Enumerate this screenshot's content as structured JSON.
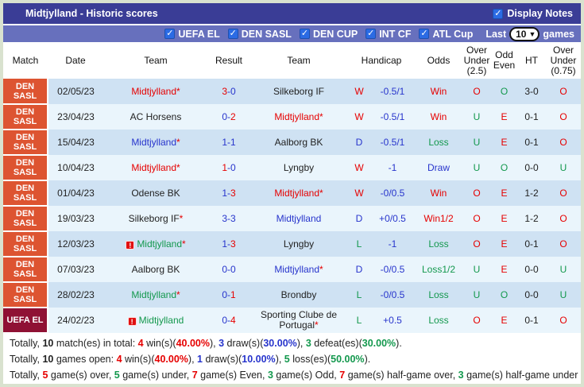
{
  "titlebar": {
    "title": "Midtjylland - Historic scores",
    "display_notes": "Display Notes"
  },
  "filterbar": {
    "checkboxes": [
      "UEFA EL",
      "DEN SASL",
      "DEN CUP",
      "INT CF",
      "ATL Cup"
    ],
    "last": "Last",
    "selected": "10",
    "games": "games"
  },
  "colors": {
    "titlebar_bg": "#3a3d96",
    "filterbar_bg": "#6770bd",
    "den_sasl_bg": "#dd5431",
    "uefa_el_bg": "#8f1134",
    "row_odd_bg": "#cfe2f3",
    "row_even_bg": "#eaf5fc",
    "win_red": "#e60000",
    "draw_blue": "#2734cc",
    "loss_green": "#13984d"
  },
  "table": {
    "headers": [
      "Match",
      "Date",
      "Team",
      "Result",
      "Team",
      "Handicap",
      "Odds",
      "Over\nUnder\n(2.5)",
      "Odd\nEven",
      "HT",
      "Over\nUnder\n(0.75)"
    ],
    "rows": [
      {
        "league": "DEN SASL",
        "league_type": "densasl",
        "date": "02/05/23",
        "home": {
          "name": "Midtjylland",
          "star": true,
          "color": "red"
        },
        "result": {
          "home": "3",
          "away": "0",
          "home_color": "red",
          "away_color": "blue"
        },
        "away": {
          "name": "Silkeborg IF",
          "star": false,
          "color": "black"
        },
        "wdl": {
          "t": "W",
          "c": "red"
        },
        "handicap": "-0.5/1",
        "odds": {
          "t": "Win",
          "c": "red"
        },
        "ou25": {
          "t": "O",
          "c": "red"
        },
        "oddeven": {
          "t": "O",
          "c": "green"
        },
        "ht": "3-0",
        "ou075": {
          "t": "O",
          "c": "red"
        }
      },
      {
        "league": "DEN SASL",
        "league_type": "densasl",
        "date": "23/04/23",
        "home": {
          "name": "AC Horsens",
          "star": false,
          "color": "black"
        },
        "result": {
          "home": "0",
          "away": "2",
          "home_color": "blue",
          "away_color": "red"
        },
        "away": {
          "name": "Midtjylland",
          "star": true,
          "color": "red"
        },
        "wdl": {
          "t": "W",
          "c": "red"
        },
        "handicap": "-0.5/1",
        "odds": {
          "t": "Win",
          "c": "red"
        },
        "ou25": {
          "t": "U",
          "c": "green"
        },
        "oddeven": {
          "t": "E",
          "c": "red"
        },
        "ht": "0-1",
        "ou075": {
          "t": "O",
          "c": "red"
        }
      },
      {
        "league": "DEN SASL",
        "league_type": "densasl",
        "date": "15/04/23",
        "home": {
          "name": "Midtjylland",
          "star": true,
          "color": "blue"
        },
        "result": {
          "home": "1",
          "away": "1",
          "home_color": "blue",
          "away_color": "blue"
        },
        "away": {
          "name": "Aalborg BK",
          "star": false,
          "color": "black"
        },
        "wdl": {
          "t": "D",
          "c": "blue"
        },
        "handicap": "-0.5/1",
        "odds": {
          "t": "Loss",
          "c": "green"
        },
        "ou25": {
          "t": "U",
          "c": "green"
        },
        "oddeven": {
          "t": "E",
          "c": "red"
        },
        "ht": "0-1",
        "ou075": {
          "t": "O",
          "c": "red"
        }
      },
      {
        "league": "DEN SASL",
        "league_type": "densasl",
        "date": "10/04/23",
        "home": {
          "name": "Midtjylland",
          "star": true,
          "color": "red"
        },
        "result": {
          "home": "1",
          "away": "0",
          "home_color": "red",
          "away_color": "blue"
        },
        "away": {
          "name": "Lyngby",
          "star": false,
          "color": "black"
        },
        "wdl": {
          "t": "W",
          "c": "red"
        },
        "handicap": "-1",
        "odds": {
          "t": "Draw",
          "c": "blue"
        },
        "ou25": {
          "t": "U",
          "c": "green"
        },
        "oddeven": {
          "t": "O",
          "c": "green"
        },
        "ht": "0-0",
        "ou075": {
          "t": "U",
          "c": "green"
        }
      },
      {
        "league": "DEN SASL",
        "league_type": "densasl",
        "date": "01/04/23",
        "home": {
          "name": "Odense BK",
          "star": false,
          "color": "black"
        },
        "result": {
          "home": "1",
          "away": "3",
          "home_color": "blue",
          "away_color": "red"
        },
        "away": {
          "name": "Midtjylland",
          "star": true,
          "color": "red"
        },
        "wdl": {
          "t": "W",
          "c": "red"
        },
        "handicap": "-0/0.5",
        "odds": {
          "t": "Win",
          "c": "red"
        },
        "ou25": {
          "t": "O",
          "c": "red"
        },
        "oddeven": {
          "t": "E",
          "c": "red"
        },
        "ht": "1-2",
        "ou075": {
          "t": "O",
          "c": "red"
        }
      },
      {
        "league": "DEN SASL",
        "league_type": "densasl",
        "date": "19/03/23",
        "home": {
          "name": "Silkeborg IF",
          "star": true,
          "color": "black"
        },
        "result": {
          "home": "3",
          "away": "3",
          "home_color": "blue",
          "away_color": "blue"
        },
        "away": {
          "name": "Midtjylland",
          "star": false,
          "color": "blue"
        },
        "wdl": {
          "t": "D",
          "c": "blue"
        },
        "handicap": "+0/0.5",
        "odds": {
          "t": "Win1/2",
          "c": "red"
        },
        "ou25": {
          "t": "O",
          "c": "red"
        },
        "oddeven": {
          "t": "E",
          "c": "red"
        },
        "ht": "1-2",
        "ou075": {
          "t": "O",
          "c": "red"
        }
      },
      {
        "league": "DEN SASL",
        "league_type": "densasl",
        "date": "12/03/23",
        "home": {
          "name": "Midtjylland",
          "star": true,
          "color": "green",
          "icon": "red-card"
        },
        "result": {
          "home": "1",
          "away": "3",
          "home_color": "blue",
          "away_color": "red"
        },
        "away": {
          "name": "Lyngby",
          "star": false,
          "color": "black"
        },
        "wdl": {
          "t": "L",
          "c": "green"
        },
        "handicap": "-1",
        "odds": {
          "t": "Loss",
          "c": "green"
        },
        "ou25": {
          "t": "O",
          "c": "red"
        },
        "oddeven": {
          "t": "E",
          "c": "red"
        },
        "ht": "0-1",
        "ou075": {
          "t": "O",
          "c": "red"
        }
      },
      {
        "league": "DEN SASL",
        "league_type": "densasl",
        "date": "07/03/23",
        "home": {
          "name": "Aalborg BK",
          "star": false,
          "color": "black"
        },
        "result": {
          "home": "0",
          "away": "0",
          "home_color": "blue",
          "away_color": "blue"
        },
        "away": {
          "name": "Midtjylland",
          "star": true,
          "color": "blue"
        },
        "wdl": {
          "t": "D",
          "c": "blue"
        },
        "handicap": "-0/0.5",
        "odds": {
          "t": "Loss1/2",
          "c": "green"
        },
        "ou25": {
          "t": "U",
          "c": "green"
        },
        "oddeven": {
          "t": "E",
          "c": "red"
        },
        "ht": "0-0",
        "ou075": {
          "t": "U",
          "c": "green"
        }
      },
      {
        "league": "DEN SASL",
        "league_type": "densasl",
        "date": "28/02/23",
        "home": {
          "name": "Midtjylland",
          "star": true,
          "color": "green"
        },
        "result": {
          "home": "0",
          "away": "1",
          "home_color": "blue",
          "away_color": "red"
        },
        "away": {
          "name": "Brondby",
          "star": false,
          "color": "black"
        },
        "wdl": {
          "t": "L",
          "c": "green"
        },
        "handicap": "-0/0.5",
        "odds": {
          "t": "Loss",
          "c": "green"
        },
        "ou25": {
          "t": "U",
          "c": "green"
        },
        "oddeven": {
          "t": "O",
          "c": "green"
        },
        "ht": "0-0",
        "ou075": {
          "t": "U",
          "c": "green"
        }
      },
      {
        "league": "UEFA EL",
        "league_type": "uefael",
        "date": "24/02/23",
        "home": {
          "name": "Midtjylland",
          "star": false,
          "color": "green",
          "icon": "red-card"
        },
        "result": {
          "home": "0",
          "away": "4",
          "home_color": "blue",
          "away_color": "red"
        },
        "away": {
          "name": "Sporting Clube de Portugal",
          "star": true,
          "color": "black"
        },
        "wdl": {
          "t": "L",
          "c": "green"
        },
        "handicap": "+0.5",
        "odds": {
          "t": "Loss",
          "c": "green"
        },
        "ou25": {
          "t": "O",
          "c": "red"
        },
        "oddeven": {
          "t": "E",
          "c": "red"
        },
        "ht": "0-1",
        "ou075": {
          "t": "O",
          "c": "red"
        }
      }
    ]
  },
  "summary": {
    "lines": [
      [
        {
          "t": "Totally, "
        },
        {
          "t": "10",
          "b": 1
        },
        {
          "t": " match(es) in total: "
        },
        {
          "t": "4",
          "c": "red"
        },
        {
          "t": " win(s)("
        },
        {
          "t": "40.00%",
          "c": "red"
        },
        {
          "t": "), "
        },
        {
          "t": "3",
          "c": "blue"
        },
        {
          "t": " draw(s)("
        },
        {
          "t": "30.00%",
          "c": "blue"
        },
        {
          "t": "), "
        },
        {
          "t": "3",
          "c": "green"
        },
        {
          "t": " defeat(es)("
        },
        {
          "t": "30.00%",
          "c": "green"
        },
        {
          "t": ")."
        }
      ],
      [
        {
          "t": "Totally, "
        },
        {
          "t": "10",
          "b": 1
        },
        {
          "t": " games open: "
        },
        {
          "t": "4",
          "c": "red"
        },
        {
          "t": " win(s)("
        },
        {
          "t": "40.00%",
          "c": "red"
        },
        {
          "t": "), "
        },
        {
          "t": "1",
          "c": "blue"
        },
        {
          "t": " draw(s)("
        },
        {
          "t": "10.00%",
          "c": "blue"
        },
        {
          "t": "), "
        },
        {
          "t": "5",
          "c": "green"
        },
        {
          "t": " loss(es)("
        },
        {
          "t": "50.00%",
          "c": "green"
        },
        {
          "t": ")."
        }
      ],
      [
        {
          "t": "Totally, "
        },
        {
          "t": "5",
          "c": "red"
        },
        {
          "t": " game(s) over, "
        },
        {
          "t": "5",
          "c": "green"
        },
        {
          "t": " game(s) under, "
        },
        {
          "t": "7",
          "c": "red"
        },
        {
          "t": " game(s) Even, "
        },
        {
          "t": "3",
          "c": "green"
        },
        {
          "t": " game(s) Odd, "
        },
        {
          "t": "7",
          "c": "red"
        },
        {
          "t": " game(s) half-game over, "
        },
        {
          "t": "3",
          "c": "green"
        },
        {
          "t": " game(s) half-game under"
        }
      ]
    ]
  }
}
